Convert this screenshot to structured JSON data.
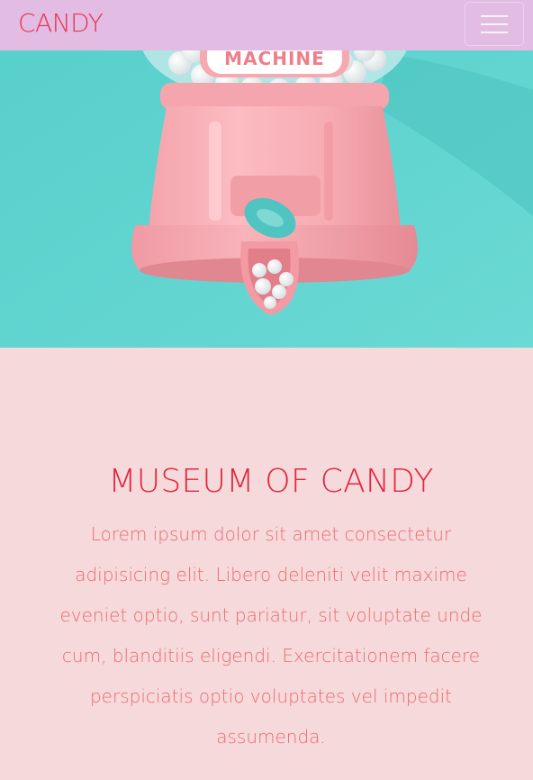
{
  "navbar": {
    "brand": "CANDY",
    "toggle_icon": "hamburger-menu-icon"
  },
  "hero": {
    "image": "pink gumball machine on teal background",
    "sign_text": "MACHINE"
  },
  "section": {
    "title": "MUSEUM OF CANDY",
    "body": "Lorem ipsum dolor sit amet consectetur adipisicing elit. Libero deleniti velit maxime eveniet optio, sunt pariatur, sit voluptate unde cum, blanditiis eligendi. Exercitationem facere perspiciatis optio voluptates vel impedit assumenda."
  },
  "colors": {
    "navbar_bg": "#e2bce3",
    "brand": "#e8344f",
    "hero_bg": "#5fd5d0",
    "page_bg": "#f5d9db",
    "title": "#e3243f",
    "body_text": "#ee6a6e"
  }
}
